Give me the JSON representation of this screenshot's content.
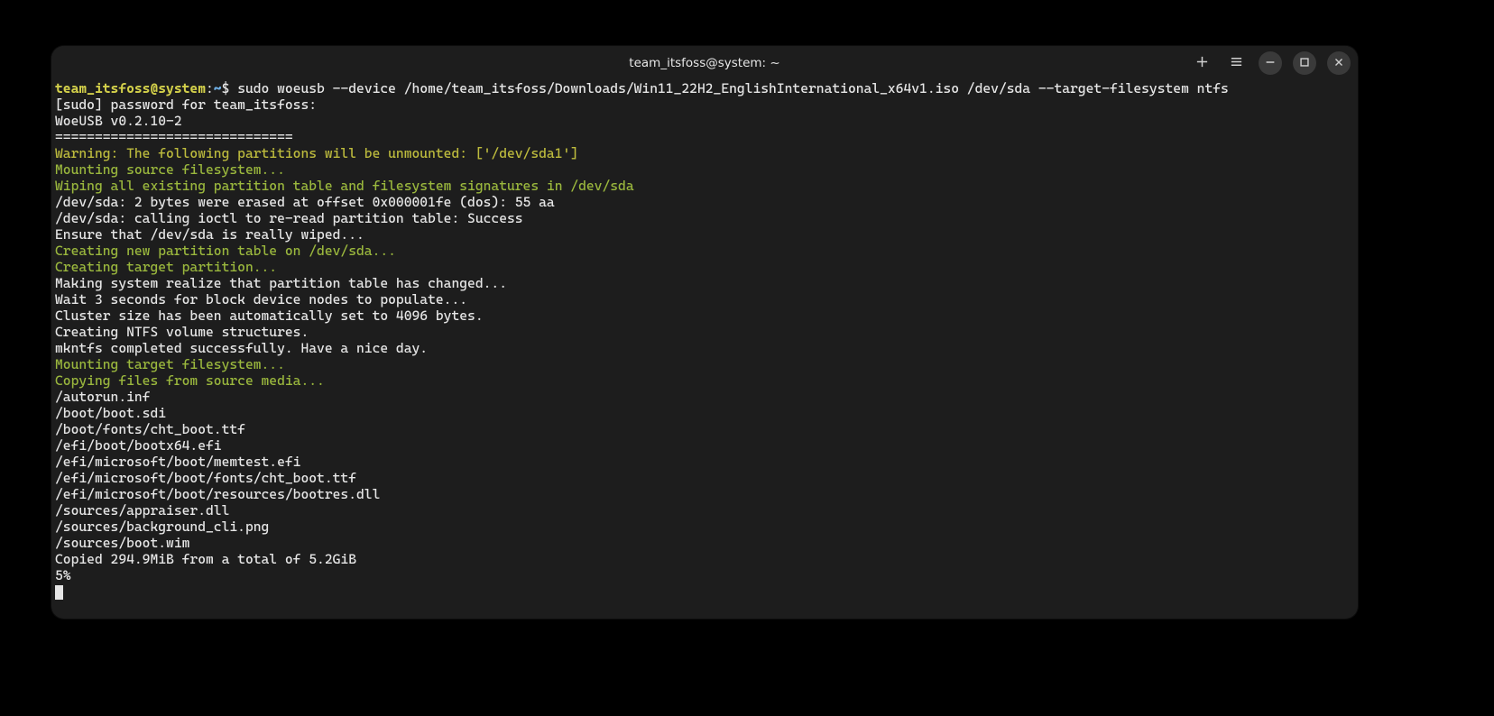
{
  "titlebar": {
    "title": "team_itsfoss@system: ~"
  },
  "prompt": {
    "user_host": "team_itsfoss@system",
    "sep": ":",
    "path": "~",
    "dollar": "$",
    "command": "sudo woeusb --device /home/team_itsfoss/Downloads/Win11_22H2_EnglishInternational_x64v1.iso /dev/sda --target-filesystem ntfs"
  },
  "lines": {
    "l01": "[sudo] password for team_itsfoss:",
    "l02": "WoeUSB v0.2.10-2",
    "l03": "==============================",
    "l04": "Warning: The following partitions will be unmounted: ['/dev/sda1']",
    "l05": "Mounting source filesystem...",
    "l06": "Wiping all existing partition table and filesystem signatures in /dev/sda",
    "l07": "/dev/sda: 2 bytes were erased at offset 0x000001fe (dos): 55 aa",
    "l08": "/dev/sda: calling ioctl to re-read partition table: Success",
    "l09": "Ensure that /dev/sda is really wiped...",
    "l10": "Creating new partition table on /dev/sda...",
    "l11": "Creating target partition...",
    "l12": "Making system realize that partition table has changed...",
    "l13": "Wait 3 seconds for block device nodes to populate...",
    "l14": "Cluster size has been automatically set to 4096 bytes.",
    "l15": "Creating NTFS volume structures.",
    "l16": "mkntfs completed successfully. Have a nice day.",
    "l17": "Mounting target filesystem...",
    "l18": "Copying files from source media...",
    "l19": "/autorun.inf",
    "l20": "/boot/boot.sdi",
    "l21": "/boot/fonts/cht_boot.ttf",
    "l22": "/efi/boot/bootx64.efi",
    "l23": "/efi/microsoft/boot/memtest.efi",
    "l24": "/efi/microsoft/boot/fonts/cht_boot.ttf",
    "l25": "/efi/microsoft/boot/resources/bootres.dll",
    "l26": "/sources/appraiser.dll",
    "l27": "/sources/background_cli.png",
    "l28": "/sources/boot.wim",
    "l29": "Copied 294.9MiB from a total of 5.2GiB",
    "l30": "5%"
  }
}
